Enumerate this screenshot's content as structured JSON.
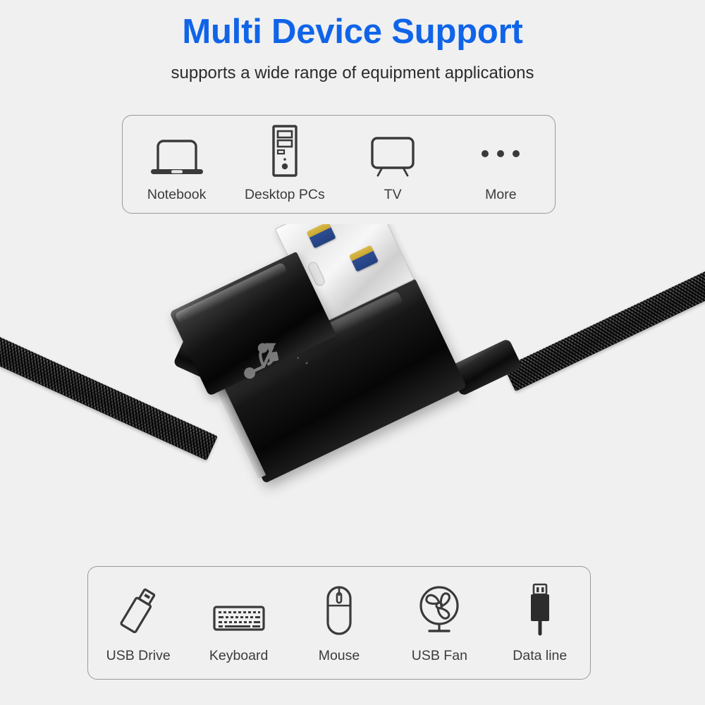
{
  "headline": "Multi Device Support",
  "subhead": "supports a wide range of equipment applications",
  "colors": {
    "background": "#f0f0f0",
    "headline": "#1064e8",
    "subhead": "#2b2b2b",
    "panel_border": "#9a9a9a",
    "icon_stroke": "#3a3a3a",
    "caption": "#3b3b3b",
    "usb_blue": "#2e4c93",
    "usb_gold": "#caa82f",
    "shield_silver": "#e6e6e6",
    "cable_black": "#0a0a0a"
  },
  "panel_top": {
    "items": [
      {
        "label": "Notebook",
        "icon": "laptop-icon"
      },
      {
        "label": "Desktop PCs",
        "icon": "desktop-tower-icon"
      },
      {
        "label": "TV",
        "icon": "tv-icon"
      },
      {
        "label": "More",
        "icon": "ellipsis-icon"
      }
    ]
  },
  "panel_bottom": {
    "items": [
      {
        "label": "USB Drive",
        "icon": "usb-flash-drive-icon"
      },
      {
        "label": "Keyboard",
        "icon": "keyboard-icon"
      },
      {
        "label": "Mouse",
        "icon": "mouse-icon"
      },
      {
        "label": "USB Fan",
        "icon": "fan-icon"
      },
      {
        "label": "Data line",
        "icon": "usb-plug-icon"
      }
    ]
  },
  "product": {
    "male_connector": "usb-a-male-connector",
    "female_connector": "usb-a-female-connector",
    "cable": "braided-nylon-cable",
    "logo": "usb-trident-logo"
  }
}
